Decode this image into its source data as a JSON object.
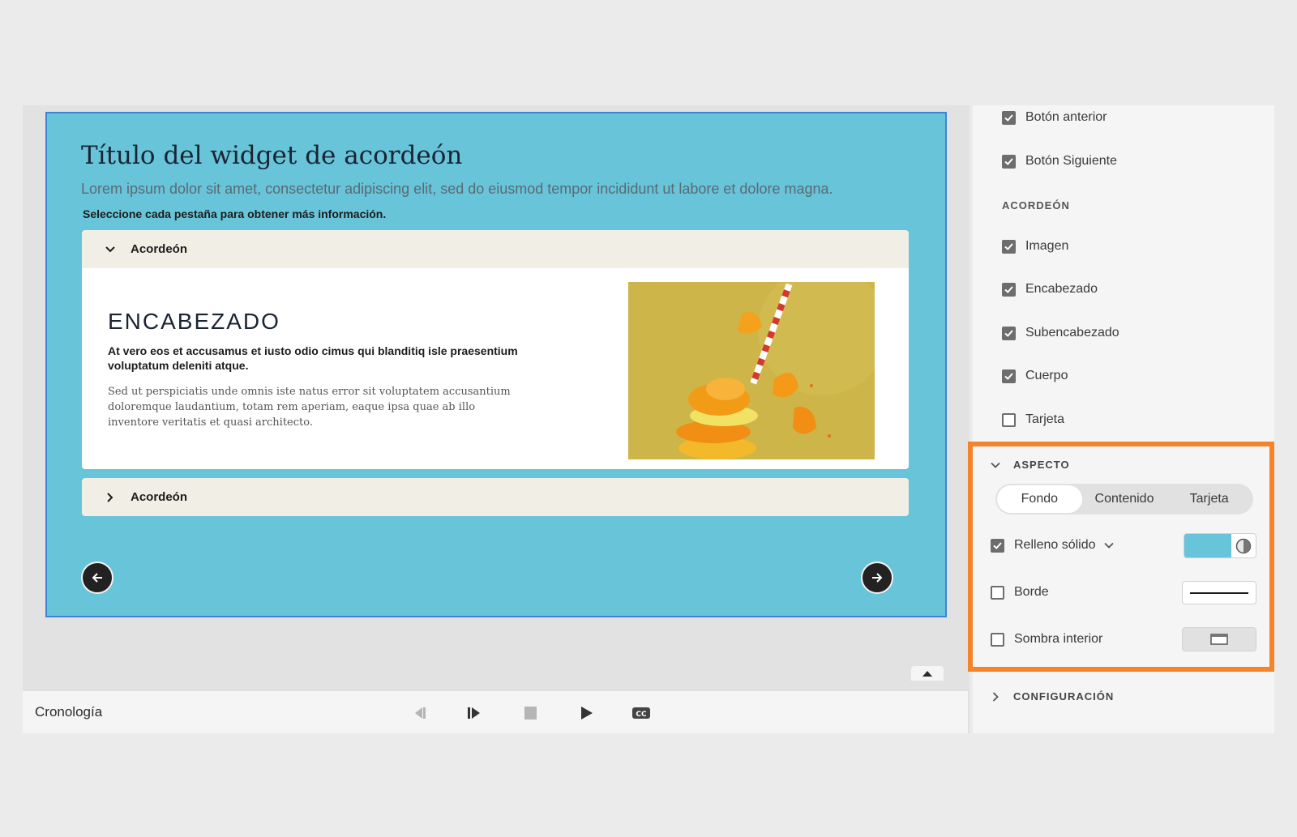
{
  "slide": {
    "title": "Título del widget de acordeón",
    "description": "Lorem ipsum dolor sit amet, consectetur adipiscing elit, sed do eiusmod tempor incididunt ut labore et dolore magna.",
    "instruction": "Seleccione cada pestaña para obtener más información.",
    "background_color": "#67c4d9"
  },
  "accordion": {
    "items": [
      {
        "label": "Acordeón",
        "expanded": true
      },
      {
        "label": "Acordeón",
        "expanded": false
      }
    ],
    "content": {
      "heading": "ENCABEZADO",
      "subheading": "At vero eos et accusamus et iusto odio cimus qui blanditiq isle praesentium voluptatum deleniti atque.",
      "body": "Sed ut perspiciatis unde omnis iste natus error sit voluptatem accusantium doloremque laudantium, totam rem aperiam, eaque ipsa quae ab illo inventore veritatis et quasi architecto."
    }
  },
  "timeline": {
    "label": "Cronología"
  },
  "panel": {
    "nav_checks": [
      {
        "label": "Botón anterior",
        "checked": true
      },
      {
        "label": "Botón Siguiente",
        "checked": true
      }
    ],
    "accordion_section": "ACORDEÓN",
    "accordion_checks": [
      {
        "label": "Imagen",
        "checked": true
      },
      {
        "label": "Encabezado",
        "checked": true
      },
      {
        "label": "Subencabezado",
        "checked": true
      },
      {
        "label": "Cuerpo",
        "checked": true
      },
      {
        "label": "Tarjeta",
        "checked": false
      }
    ],
    "aspecto": {
      "title": "ASPECTO",
      "tabs": [
        "Fondo",
        "Contenido",
        "Tarjeta"
      ],
      "active_tab": "Fondo",
      "solid_fill": {
        "label": "Relleno sólido",
        "checked": true
      },
      "border": {
        "label": "Borde",
        "checked": false
      },
      "inner_shadow": {
        "label": "Sombra interior",
        "checked": false
      }
    },
    "config": {
      "title": "CONFIGURACIÓN"
    },
    "highlight_color": "#f5832a"
  }
}
